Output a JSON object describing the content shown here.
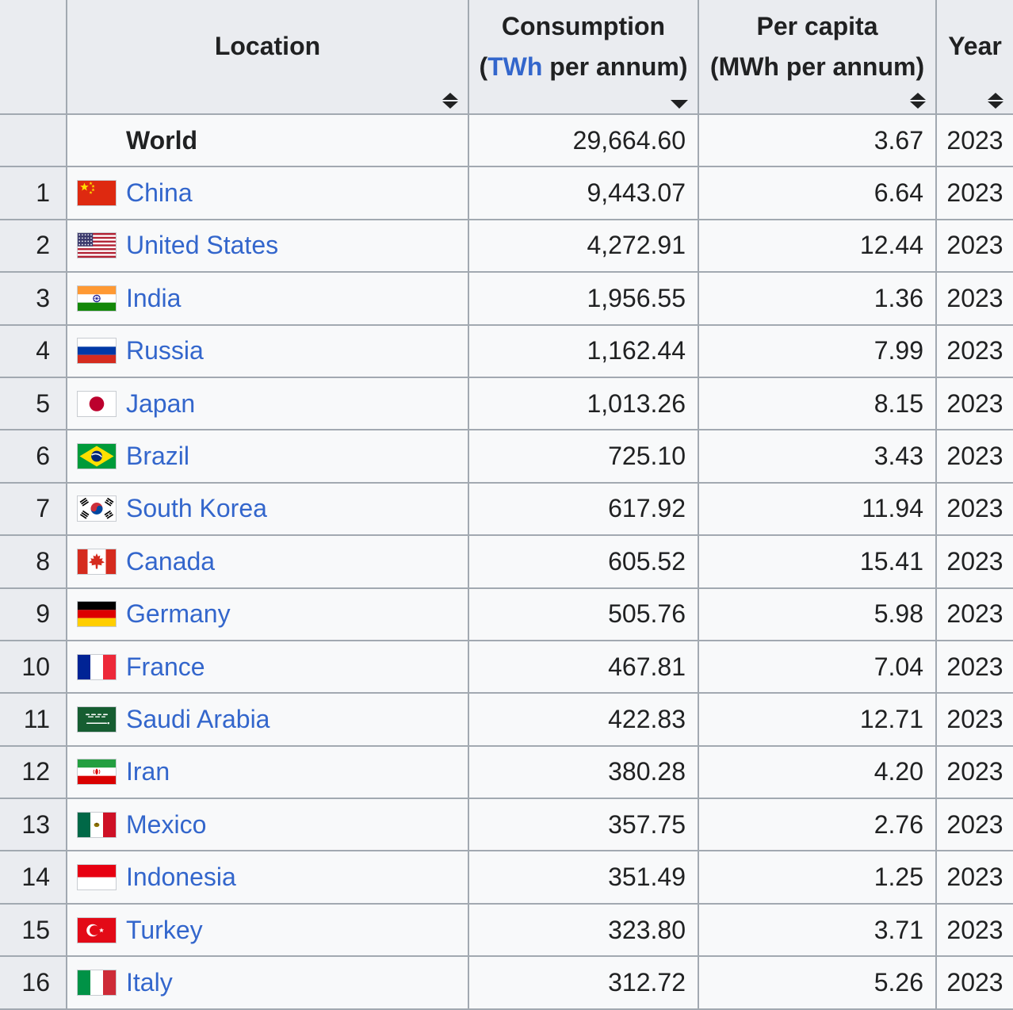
{
  "table": {
    "headers": {
      "rank": "",
      "location": {
        "label": "Location"
      },
      "consumption": {
        "line1": "Consumption",
        "paren_open": "(",
        "unit_link": "TWh",
        "rest": " per annum)"
      },
      "per_capita": {
        "line1": "Per capita",
        "line2": "(MWh per annum)"
      },
      "year": {
        "label": "Year"
      }
    },
    "sort_state": {
      "location": "unsorted",
      "consumption": "descending",
      "per_capita": "unsorted",
      "year": "unsorted"
    },
    "rows": [
      {
        "rank": "",
        "location": "World",
        "flag": null,
        "is_world": true,
        "consumption": "29,664.60",
        "per_capita": "3.67",
        "year": "2023"
      },
      {
        "rank": "1",
        "location": "China",
        "flag": "china",
        "is_world": false,
        "consumption": "9,443.07",
        "per_capita": "6.64",
        "year": "2023"
      },
      {
        "rank": "2",
        "location": "United States",
        "flag": "united-states",
        "is_world": false,
        "consumption": "4,272.91",
        "per_capita": "12.44",
        "year": "2023"
      },
      {
        "rank": "3",
        "location": "India",
        "flag": "india",
        "is_world": false,
        "consumption": "1,956.55",
        "per_capita": "1.36",
        "year": "2023"
      },
      {
        "rank": "4",
        "location": "Russia",
        "flag": "russia",
        "is_world": false,
        "consumption": "1,162.44",
        "per_capita": "7.99",
        "year": "2023"
      },
      {
        "rank": "5",
        "location": "Japan",
        "flag": "japan",
        "is_world": false,
        "consumption": "1,013.26",
        "per_capita": "8.15",
        "year": "2023"
      },
      {
        "rank": "6",
        "location": "Brazil",
        "flag": "brazil",
        "is_world": false,
        "consumption": "725.10",
        "per_capita": "3.43",
        "year": "2023"
      },
      {
        "rank": "7",
        "location": "South Korea",
        "flag": "south-korea",
        "is_world": false,
        "consumption": "617.92",
        "per_capita": "11.94",
        "year": "2023"
      },
      {
        "rank": "8",
        "location": "Canada",
        "flag": "canada",
        "is_world": false,
        "consumption": "605.52",
        "per_capita": "15.41",
        "year": "2023"
      },
      {
        "rank": "9",
        "location": "Germany",
        "flag": "germany",
        "is_world": false,
        "consumption": "505.76",
        "per_capita": "5.98",
        "year": "2023"
      },
      {
        "rank": "10",
        "location": "France",
        "flag": "france",
        "is_world": false,
        "consumption": "467.81",
        "per_capita": "7.04",
        "year": "2023"
      },
      {
        "rank": "11",
        "location": "Saudi Arabia",
        "flag": "saudi-arabia",
        "is_world": false,
        "consumption": "422.83",
        "per_capita": "12.71",
        "year": "2023"
      },
      {
        "rank": "12",
        "location": "Iran",
        "flag": "iran",
        "is_world": false,
        "consumption": "380.28",
        "per_capita": "4.20",
        "year": "2023"
      },
      {
        "rank": "13",
        "location": "Mexico",
        "flag": "mexico",
        "is_world": false,
        "consumption": "357.75",
        "per_capita": "2.76",
        "year": "2023"
      },
      {
        "rank": "14",
        "location": "Indonesia",
        "flag": "indonesia",
        "is_world": false,
        "consumption": "351.49",
        "per_capita": "1.25",
        "year": "2023"
      },
      {
        "rank": "15",
        "location": "Turkey",
        "flag": "turkey",
        "is_world": false,
        "consumption": "323.80",
        "per_capita": "3.71",
        "year": "2023"
      },
      {
        "rank": "16",
        "location": "Italy",
        "flag": "italy",
        "is_world": false,
        "consumption": "312.72",
        "per_capita": "5.26",
        "year": "2023"
      }
    ]
  },
  "colors": {
    "header_bg": "#eaecf0",
    "row_bg": "#f8f9fa",
    "border": "#a2a9b1",
    "link": "#3366cc",
    "text": "#202122"
  }
}
